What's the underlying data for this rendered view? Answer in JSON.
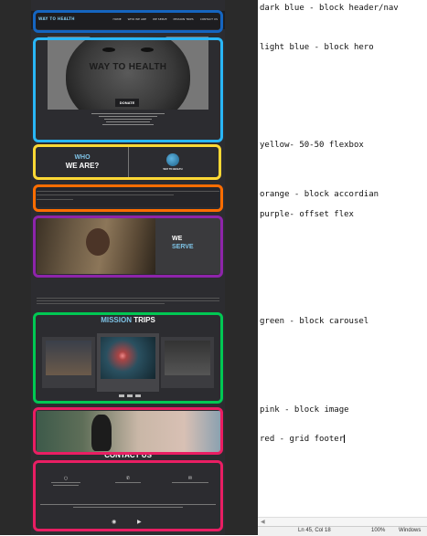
{
  "site": {
    "nav": {
      "logo": "WAY TO HEALTH",
      "links": [
        "HOME",
        "WHO WE ARE",
        "WE SERVE",
        "MISSION TRIPS",
        "CONTACT US"
      ]
    },
    "hero": {
      "title": "WAY TO HEALTH",
      "donate_label": "DONATE"
    },
    "who": {
      "line1": "WHO",
      "line2": "WE ARE?",
      "brand": "WAY TO HEALTH"
    },
    "serve": {
      "line1": "WE",
      "line2": "SERVE"
    },
    "trips": {
      "heading_a": "MISSION",
      "heading_b": "TRIPS"
    },
    "contact": {
      "heading": "CONTACT US"
    }
  },
  "colors": {
    "nav": "#1565c0",
    "hero": "#29b6f6",
    "flex": "#fdd835",
    "accordion": "#ff6d00",
    "offset": "#8e24aa",
    "carousel": "#00c853",
    "image": "#e91e63",
    "footer": "#e91e63"
  },
  "editor": {
    "lines": [
      "dark blue - block header/nav",
      "light blue - block hero",
      "yellow- 50-50 flexbox",
      "orange - block accordian",
      "purple- offset flex",
      "green - block carousel",
      "pink - block image",
      "red - grid footer"
    ]
  },
  "status": {
    "position": "Ln 45, Col 18",
    "zoom": "100%",
    "eol": "Windows"
  }
}
